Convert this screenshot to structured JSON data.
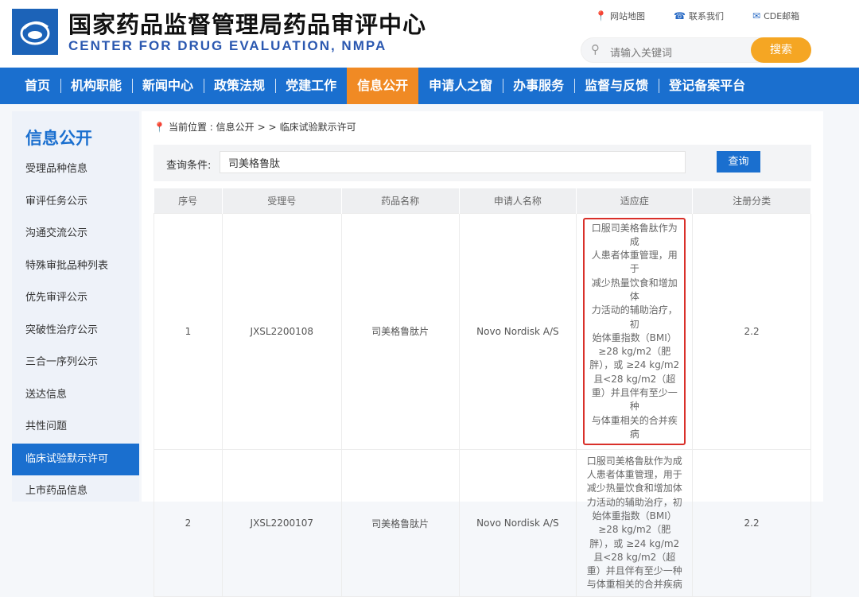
{
  "header": {
    "title_cn": "国家药品监督管理局药品审评中心",
    "title_en": "CENTER FOR DRUG EVALUATION, NMPA",
    "links": [
      {
        "icon": "map-pin-icon",
        "label": "网站地图"
      },
      {
        "icon": "phone-icon",
        "label": "联系我们"
      },
      {
        "icon": "mail-icon",
        "label": "CDE邮箱"
      }
    ],
    "search": {
      "placeholder": "请输入关键词",
      "button": "搜索"
    }
  },
  "nav": [
    "首页",
    "机构职能",
    "新闻中心",
    "政策法规",
    "党建工作",
    "信息公开",
    "申请人之窗",
    "办事服务",
    "监督与反馈",
    "登记备案平台"
  ],
  "nav_active": "信息公开",
  "sidebar": {
    "title": "信息公开",
    "items": [
      "受理品种信息",
      "审评任务公示",
      "沟通交流公示",
      "特殊审批品种列表",
      "优先审评公示",
      "突破性治疗公示",
      "三合一序列公示",
      "送达信息",
      "共性问题",
      "临床试验默示许可",
      "上市药品信息"
    ],
    "active": "临床试验默示许可"
  },
  "breadcrumb": {
    "prefix": "当前位置 : 信息公开",
    "sep": "> >",
    "current": "临床试验默示许可"
  },
  "query": {
    "label": "查询条件:",
    "value": "司美格鲁肽",
    "button": "查询"
  },
  "table": {
    "headers": [
      "序号",
      "受理号",
      "药品名称",
      "申请人名称",
      "适应症",
      "注册分类"
    ],
    "rows": [
      [
        "1",
        "JXSL2200108",
        "司美格鲁肽片",
        "Novo Nordisk A/S",
        "口服司美格鲁肽作为成\n人患者体重管理，用于\n减少热量饮食和增加体\n力活动的辅助治疗，初\n始体重指数（BMI）\n≥28 kg/m2（肥\n胖），或 ≥24 kg/m2\n且<28 kg/m2（超\n重）并且伴有至少一种\n与体重相关的合并疾病",
        "2.2"
      ],
      [
        "2",
        "JXSL2200107",
        "司美格鲁肽片",
        "Novo Nordisk A/S",
        "口服司美格鲁肽作为成\n人患者体重管理，用于\n减少热量饮食和增加体\n力活动的辅助治疗，初\n始体重指数（BMI）\n≥28 kg/m2（肥\n胖），或 ≥24 kg/m2\n且<28 kg/m2（超\n重）并且伴有至少一种\n与体重相关的合并疾病",
        "2.2"
      ]
    ]
  },
  "colors": {
    "brand": "#1a6fcf",
    "active": "#f08a24",
    "search_btn": "#f5a623",
    "highlight": "#d9302a"
  }
}
